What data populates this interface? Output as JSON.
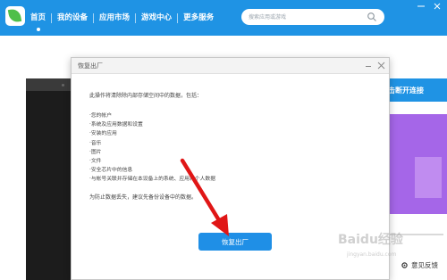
{
  "app": {
    "nav": [
      {
        "label": "首页"
      },
      {
        "label": "我的设备"
      },
      {
        "label": "应用市场"
      },
      {
        "label": "游戏中心"
      },
      {
        "label": "更多服务"
      }
    ],
    "search_placeholder": "搜索应用或游戏",
    "accent_color": "#1f93e4",
    "connect_button_label": "击断开连接",
    "feedback_label": "意见反馈"
  },
  "dialog": {
    "title": "恢复出厂",
    "intro": "此操作将清除除内部存储空间中的数据，包括：",
    "items": [
      "·您的帐户",
      "·系统及应用数据和设置",
      "·安装的应用",
      "·音乐",
      "·图片",
      "·文件",
      "·安全芯片中的信息",
      "·与帐号关联并存储在本设备上的系统、应用和个人数据"
    ],
    "footnote": "为防止数据丢失，建议先备份设备中的数据。",
    "confirm_button": "恢复出厂"
  },
  "watermark": {
    "text": "Baidu经验",
    "sub": "jingyan.baidu.com"
  }
}
